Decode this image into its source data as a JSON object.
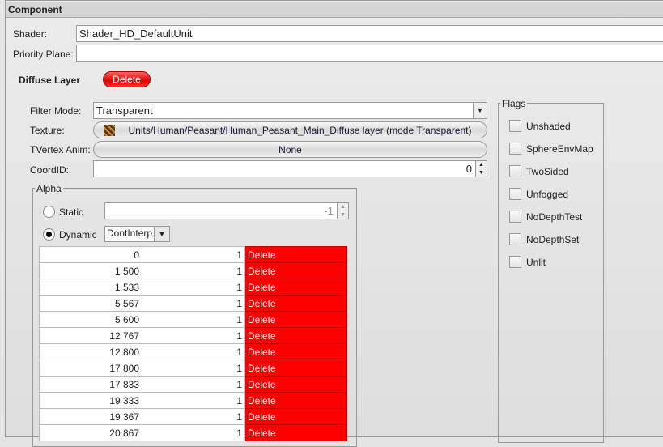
{
  "panel_title": "Component",
  "shader": {
    "label": "Shader:",
    "value": "Shader_HD_DefaultUnit"
  },
  "priority_plane": {
    "label": "Priority Plane:",
    "value": ""
  },
  "layer": {
    "title": "Diffuse Layer",
    "delete_label": "Delete"
  },
  "filter_mode": {
    "label": "Filter Mode:",
    "value": "Transparent"
  },
  "texture": {
    "label": "Texture:",
    "value": "Units/Human/Peasant/Human_Peasant_Main_Diffuse layer (mode Transparent)"
  },
  "tvertex": {
    "label": "TVertex Anim:",
    "value": "None"
  },
  "coord": {
    "label": "CoordID:",
    "value": "0"
  },
  "alpha": {
    "title": "Alpha",
    "static_label": "Static",
    "static_value": "-1",
    "dynamic_label": "Dynamic",
    "interp": "DontInterp",
    "rows": [
      [
        "0",
        "1",
        "Delete"
      ],
      [
        "1 500",
        "1",
        "Delete"
      ],
      [
        "1 533",
        "1",
        "Delete"
      ],
      [
        "5 567",
        "1",
        "Delete"
      ],
      [
        "5 600",
        "1",
        "Delete"
      ],
      [
        "12 767",
        "1",
        "Delete"
      ],
      [
        "12 800",
        "1",
        "Delete"
      ],
      [
        "17 800",
        "1",
        "Delete"
      ],
      [
        "17 833",
        "1",
        "Delete"
      ],
      [
        "19 333",
        "1",
        "Delete"
      ],
      [
        "19 367",
        "1",
        "Delete"
      ],
      [
        "20 867",
        "1",
        "Delete"
      ]
    ]
  },
  "flags": {
    "title": "Flags",
    "items": [
      "Unshaded",
      "SphereEnvMap",
      "TwoSided",
      "Unfogged",
      "NoDepthTest",
      "NoDepthSet",
      "Unlit"
    ]
  }
}
